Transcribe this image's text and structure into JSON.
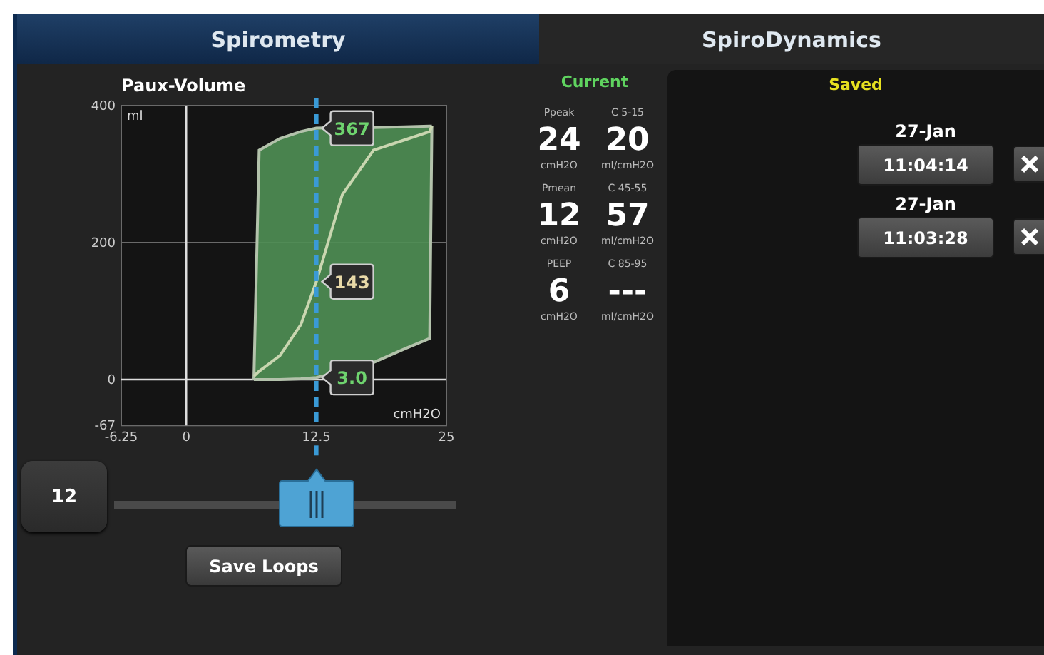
{
  "tabs": [
    {
      "label": "Spirometry",
      "selected": true
    },
    {
      "label": "SpiroDynamics",
      "selected": false
    }
  ],
  "loop_panel": {
    "title": "Paux-Volume",
    "loop_plot": {
      "y_unit": "ml",
      "x_unit": "cmH2O",
      "y_ticks": [
        "400",
        "200",
        "0",
        "-67"
      ],
      "x_ticks": [
        "-6.25",
        "0",
        "12.5",
        "25"
      ],
      "cursor_values": [
        {
          "text": "367",
          "color": "#6fd46f"
        },
        {
          "text": "143",
          "color": "#e8d9a8"
        },
        {
          "text": "3.0",
          "color": "#6fd46f"
        }
      ]
    },
    "slider": {
      "value": "12",
      "level": 0.59
    },
    "save_button": "Save Loops"
  },
  "current": {
    "title": "Current",
    "metrics": [
      {
        "label": "Ppeak",
        "value": "24",
        "unit": "cmH2O"
      },
      {
        "label": "C 5-15",
        "value": "20",
        "unit": "ml/cmH2O"
      },
      {
        "label": "Pmean",
        "value": "12",
        "unit": "cmH2O"
      },
      {
        "label": "C 45-55",
        "value": "57",
        "unit": "ml/cmH2O"
      },
      {
        "label": "PEEP",
        "value": "6",
        "unit": "cmH2O"
      },
      {
        "label": "C 85-95",
        "value": "---",
        "unit": "ml/cmH2O"
      }
    ]
  },
  "saved": {
    "title": "Saved",
    "entries": [
      {
        "date": "27-Jan",
        "time": "11:04:14"
      },
      {
        "date": "27-Jan",
        "time": "11:03:28"
      }
    ]
  }
}
